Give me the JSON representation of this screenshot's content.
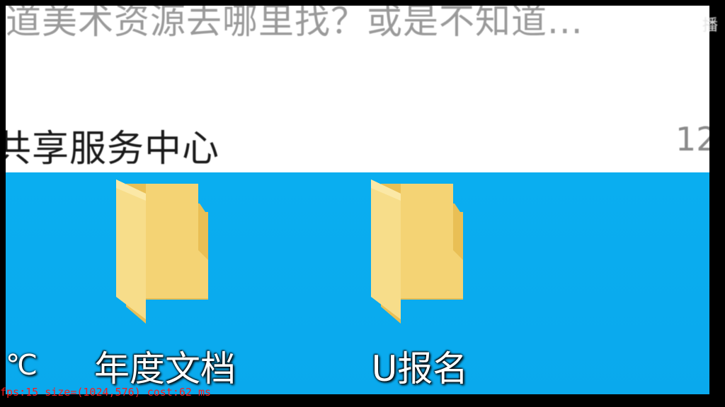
{
  "popup": {
    "headline": "道美术资源去哪里找？或是不知道...",
    "title": "共享服务中心",
    "time": "12",
    "corner_mark": "播"
  },
  "desktop": {
    "edge_char": "℃",
    "folders": [
      {
        "label": "年度文档",
        "icon": "folder-icon"
      },
      {
        "label": "U报名",
        "icon": "folder-icon"
      }
    ]
  },
  "status": {
    "text": "fps:15 size=(1024,576) cost:62 ms"
  },
  "colors": {
    "desktop_blue": "#0aaef0",
    "folder_yellow": "#f2d06b",
    "status_red": "#ff1a1a"
  }
}
